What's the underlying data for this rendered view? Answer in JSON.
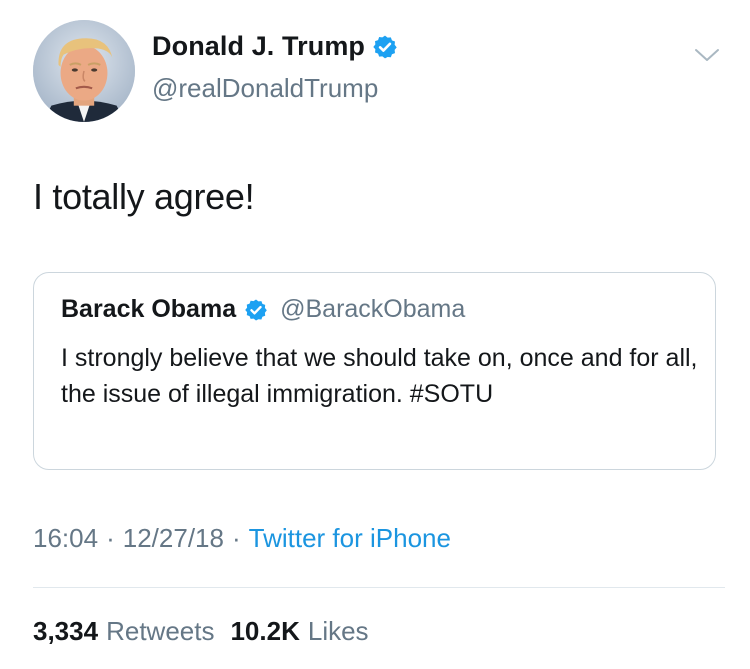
{
  "tweet": {
    "author": {
      "display_name": "Donald J. Trump",
      "handle": "@realDonaldTrump",
      "verified": true
    },
    "text": "I totally agree!",
    "quoted": {
      "display_name": "Barack Obama",
      "handle": "@BarackObama",
      "verified": true,
      "text": "I strongly believe that we should take on, once and for all, the issue of illegal immigration. #SOTU"
    },
    "meta": {
      "time": "16:04",
      "separator": "·",
      "date": "12/27/18",
      "source": "Twitter for iPhone"
    },
    "stats": {
      "retweets_count": "3,334",
      "retweets_label": "Retweets",
      "likes_count": "10.2K",
      "likes_label": "Likes"
    }
  },
  "colors": {
    "text_primary": "#14171a",
    "text_secondary": "#657786",
    "link_blue": "#1b95e0",
    "verified_blue": "#1da1f2",
    "border": "#ccd6dd"
  },
  "icons": {
    "verified": "verified-badge-icon",
    "menu": "chevron-down-icon"
  }
}
